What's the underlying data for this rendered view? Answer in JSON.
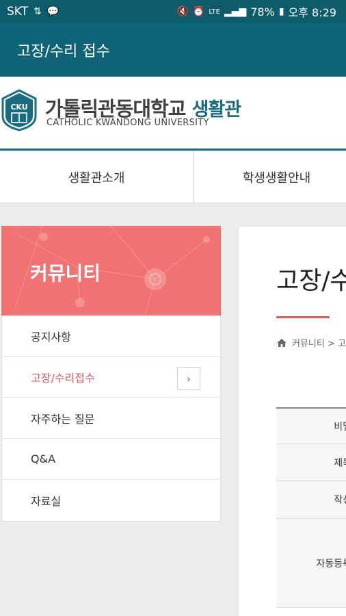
{
  "status_bar": {
    "carrier": "SKT",
    "network": "LTE",
    "battery": "78%",
    "time": "오후 8:29"
  },
  "app_bar": {
    "title": "고장/수리 접수"
  },
  "brand": {
    "logo_text": "CKU",
    "name_kr": "가톨릭관동대학교",
    "name_accent": "생활관",
    "name_en": "CATHOLIC KWANDONG UNIVERSITY"
  },
  "topnav": {
    "items": [
      {
        "label": "생활관소개"
      },
      {
        "label": "학생생활안내"
      }
    ]
  },
  "sidebar": {
    "title": "커뮤니티",
    "items": [
      {
        "label": "공지사항",
        "active": false
      },
      {
        "label": "고장/수리접수",
        "active": true,
        "chevron": "›"
      },
      {
        "label": "자주하는 질문",
        "active": false
      },
      {
        "label": "Q&A",
        "active": false
      },
      {
        "label": "자료실",
        "active": false
      }
    ]
  },
  "content": {
    "page_title": "고장/수",
    "breadcrumb": "커뮤니티 > 고",
    "form_rows": [
      {
        "label": "비밀"
      },
      {
        "label": "제목"
      },
      {
        "label": "작성"
      },
      {
        "label": "자동등록"
      }
    ]
  },
  "colors": {
    "status_bar": "#0d5c6c",
    "app_bar": "#0f6477",
    "brand_accent": "#1a6c80",
    "sidebar_header": "#f07272",
    "active_item": "#e05a5a"
  }
}
